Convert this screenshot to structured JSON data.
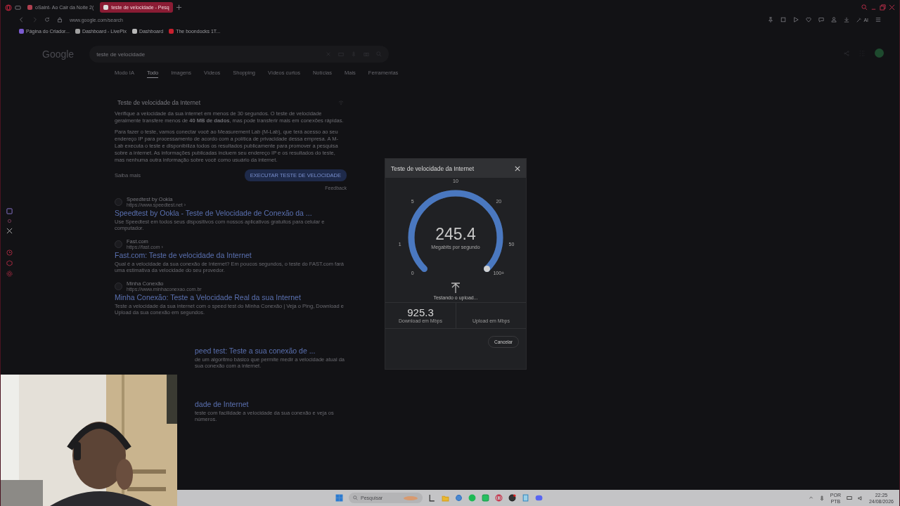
{
  "browser": {
    "tabs": [
      {
        "title": "oSaint- Ao Cair da Noite 2(",
        "selected": false
      },
      {
        "title": "teste de velocidade - Pesq",
        "selected": true
      }
    ],
    "address": "www.google.com/search",
    "bookmarks": [
      "Página do Criador...",
      "Dashboard - LivePix",
      "Dashboard",
      "The boondocks 1T..."
    ],
    "ai_label": "AI"
  },
  "google": {
    "logo": "Google",
    "search_value": "teste de velocidade",
    "tabs": [
      {
        "label": "Modo IA",
        "selected": false
      },
      {
        "label": "Todo",
        "selected": true
      },
      {
        "label": "Imagens",
        "selected": false
      },
      {
        "label": "Vídeos",
        "selected": false
      },
      {
        "label": "Shopping",
        "selected": false
      },
      {
        "label": "Vídeos curtos",
        "selected": false
      },
      {
        "label": "Notícias",
        "selected": false
      },
      {
        "label": "Mais",
        "selected": false
      },
      {
        "label": "Ferramentas",
        "selected": false
      }
    ],
    "card": {
      "title": "Teste de velocidade da Internet",
      "paragraphs": [
        "Verifique a velocidade da sua internet em menos de 30 segundos. O teste de velocidade geralmente transfere menos de **40 MB de dados**, mas pode transferir mais em conexões rápidas.",
        "Para fazer o teste, vamos conectar você ao Measurement Lab (M-Lab), que terá acesso ao seu endereço IP para processamento de acordo com a política de privacidade dessa empresa. A M-Lab executa o teste e disponibiliza todos os resultados publicamente para promover a pesquisa sobre a internet. As informações publicadas incluem seu endereço IP e os resultados do teste, mas nenhuma outra informação sobre você como usuário da internet."
      ],
      "more": "Saiba mais",
      "button": "EXECUTAR TESTE DE VELOCIDADE",
      "feedback": "Feedback"
    },
    "results": [
      {
        "kind": "full",
        "site": "Speedtest by Ookla",
        "url": "https://www.speedtest.net ›",
        "title": "Speedtest by Ookla - Teste de Velocidade de Conexão da ...",
        "snippet": "Use Speedtest em todos seus dispositivos com nossos aplicativos gratuitos para celular e computador."
      },
      {
        "kind": "full",
        "site": "Fast.com",
        "url": "https://fast.com ›",
        "title": "Fast.com: Teste de velocidade da Internet",
        "snippet": "Qual é a velocidade da sua conexão de Internet? Em poucos segundos, o teste do FAST.com fará uma estimativa da velocidade do seu provedor."
      },
      {
        "kind": "full",
        "site": "Minha Conexão",
        "url": "https://www.minhaconexao.com.br",
        "title": "Minha Conexão: Teste a Velocidade Real da sua Internet",
        "snippet": "Teste a velocidade da sua internet com o speed test do Minha Conexão | Veja o Ping, Download e Upload da sua conexão em segundos."
      },
      {
        "kind": "partial",
        "title": "peed test: Teste a sua conexão de ...",
        "snippet": "de um algoritmo básico que permite medir a velocidade atual da sua conexão com a internet."
      },
      {
        "kind": "partial",
        "title": "dade de Internet",
        "snippet": "teste com facilidade a velocidade da sua conexão e veja os números."
      }
    ]
  },
  "dialog": {
    "title": "Teste de velocidade da Internet",
    "gauge": {
      "level": 1,
      "ticks": [
        "0",
        "1",
        "5",
        "10",
        "20",
        "50",
        "100+"
      ],
      "value": "245.4",
      "unit": "Megabits por segundo",
      "status": "Testando o upload..."
    },
    "download": {
      "value": "925.3",
      "label": "Download em Mbps"
    },
    "upload": {
      "label": "Upload em Mbps"
    },
    "cancel": "Cancelar"
  },
  "taskbar": {
    "search_placeholder": "Pesquisar",
    "lang_1": "POR",
    "lang_2": "PTB",
    "time": "22:25",
    "date": "24/08/2026"
  }
}
